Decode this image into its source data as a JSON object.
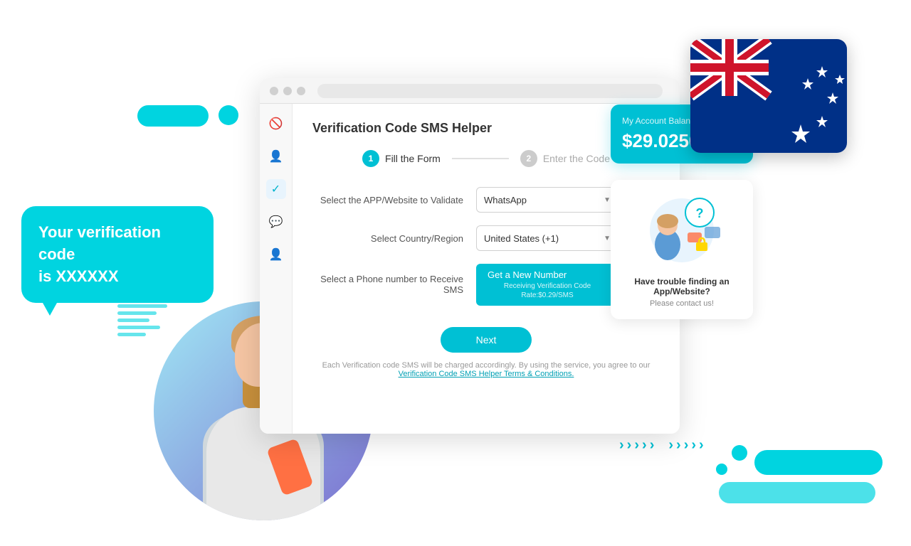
{
  "page": {
    "title": "Verification Code SMS Helper"
  },
  "speech_bubble": {
    "line1": "Your verification code",
    "line2": "is XXXXXX"
  },
  "steps": [
    {
      "number": "1",
      "label": "Fill the Form",
      "active": true
    },
    {
      "number": "2",
      "label": "Enter the Code",
      "active": false
    }
  ],
  "form": {
    "field1_label": "Select the APP/Website to Validate",
    "field1_value": "WhatsApp",
    "field2_label": "Select Country/Region",
    "field2_value": "United States (+1)",
    "field3_label": "Select a Phone number to Receive SMS",
    "btn_get_number": "Get a New Number",
    "btn_get_number_sub": "Receiving Verification Code Rate:$0.29/SMS"
  },
  "next_button": "Next",
  "terms": {
    "prefix": "Each Verification code SMS will be charged accordingly. By using the service, you agree to our",
    "link": "Verification Code SMS Helper Terms & Conditions."
  },
  "account": {
    "label": "My Account Balance",
    "balance": "$29.0250"
  },
  "help": {
    "title": "Have trouble finding an App/Website?",
    "subtitle": "Please contact us!"
  },
  "sidebar_icons": [
    "🚫",
    "👤",
    "✓",
    "💬",
    "👤"
  ],
  "chevrons": [
    "›",
    "›",
    "›",
    "›",
    "›",
    "›",
    "›",
    "›",
    "›",
    "›"
  ],
  "colors": {
    "primary_cyan": "#00c0d4",
    "accent": "#00d4e0",
    "flag_blue": "#003087",
    "flag_red": "#cf142b"
  }
}
